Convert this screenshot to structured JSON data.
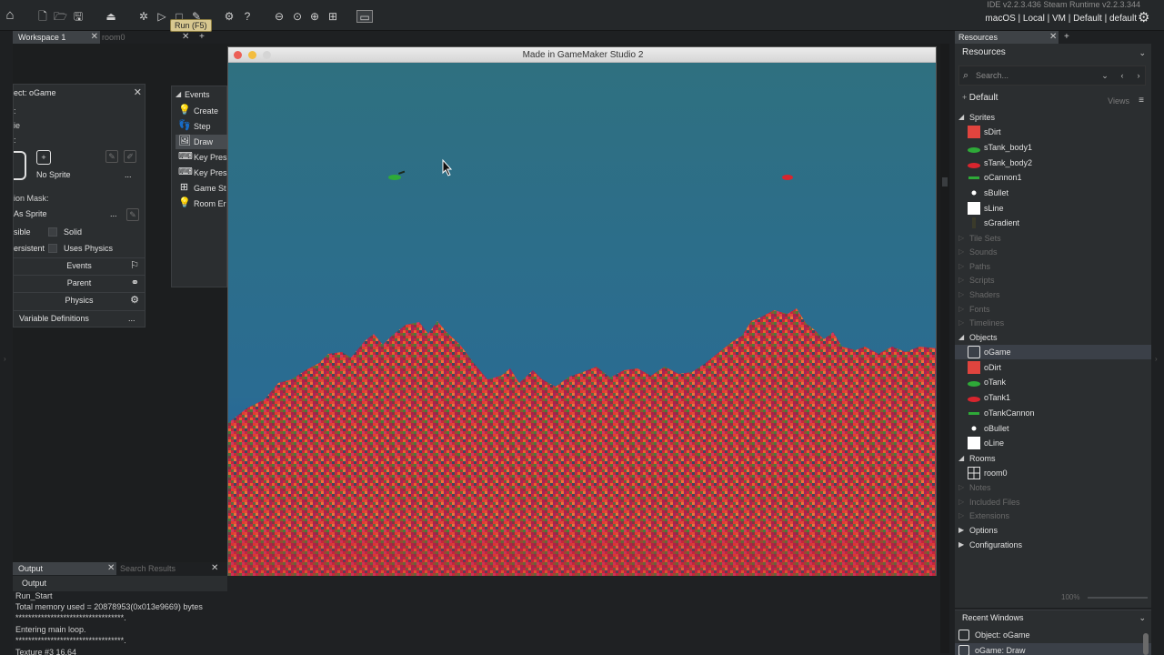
{
  "toolbar": {
    "tooltip": "Run (F5)",
    "ide_version": "IDE v2.2.3.436 Steam  Runtime v2.2.3.344",
    "target_line": "macOS | Local | VM | Default | default"
  },
  "workspace_tabs": {
    "active": "Workspace 1",
    "inactive": "room0"
  },
  "object_editor": {
    "title": "ect: oGame",
    "frag_lines": [
      ":",
      "ie",
      ":"
    ],
    "sprite_label": "No Sprite",
    "collision_mask_label": "ion Mask:",
    "collision_mask_value": "As Sprite",
    "visible_label": "sible",
    "solid_label": "Solid",
    "persistent_label": "ersistent",
    "uses_physics_label": "Uses Physics",
    "events_button": "Events",
    "parent_button": "Parent",
    "physics_button": "Physics",
    "variable_definitions": "Variable Definitions",
    "more": "..."
  },
  "events_panel": {
    "title": "Events",
    "items": [
      "Create",
      "Step",
      "Draw",
      "Key Pres",
      "Key Pres",
      "Game St",
      "Room Er"
    ]
  },
  "game_window": {
    "title": "Made in GameMaker Studio 2",
    "colors": {
      "sky_top": "#2f7080",
      "sky_bottom": "#1f5ba8",
      "terrain_base": "#c9253e",
      "green_tank": "#2eaa38",
      "red_tank": "#d8252e"
    }
  },
  "output": {
    "tab_label": "Output",
    "search_tab_label": "Search Results",
    "header": "Output",
    "lines": [
      "Run_Start",
      "Total memory used = 20878953(0x013e9669) bytes",
      "**********************************.",
      "Entering main loop.",
      "**********************************.",
      "Texture #3 16,64"
    ]
  },
  "resources": {
    "tab_label": "Resources",
    "header": "Resources",
    "search_placeholder": "Search...",
    "group_default": "Default",
    "views_label": "Views",
    "tree": {
      "sprites_label": "Sprites",
      "sprites": [
        "sDirt",
        "sTank_body1",
        "sTank_body2",
        "oCannon1",
        "sBullet",
        "sLine",
        "sGradient"
      ],
      "tile_sets_label": "Tile Sets",
      "sounds_label": "Sounds",
      "paths_label": "Paths",
      "scripts_label": "Scripts",
      "shaders_label": "Shaders",
      "fonts_label": "Fonts",
      "timelines_label": "Timelines",
      "objects_label": "Objects",
      "objects": [
        "oGame",
        "oDirt",
        "oTank",
        "oTank1",
        "oTankCannon",
        "oBullet",
        "oLine"
      ],
      "rooms_label": "Rooms",
      "rooms": [
        "room0"
      ],
      "notes_label": "Notes",
      "included_files_label": "Included Files",
      "extensions_label": "Extensions",
      "options_label": "Options",
      "configurations_label": "Configurations"
    },
    "zoom": "100%"
  },
  "recent_windows": {
    "title": "Recent Windows",
    "items": [
      "Object: oGame",
      "oGame: Draw"
    ]
  }
}
